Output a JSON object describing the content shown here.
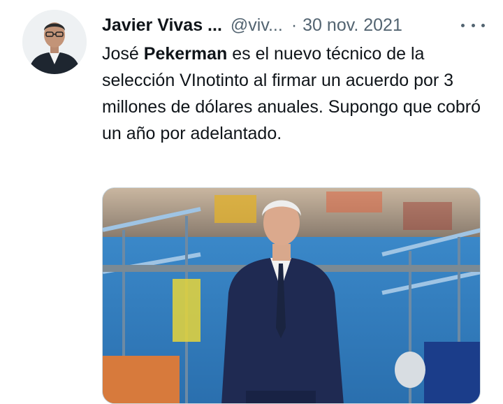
{
  "author": {
    "display_name": "Javier Vivas ...",
    "handle": "@viv...",
    "separator": "·",
    "date": "30 nov. 2021"
  },
  "tweet": {
    "text_part1": "José ",
    "text_bold": "Pekerman",
    "text_part2": " es el nuevo técnico de la selección VInotinto al firmar un acuerdo por 3 millones de dólares anuales. Supongo que cobró un año por adelantado."
  },
  "icons": {
    "more": "more-horizontal-icon",
    "avatar": "profile-avatar"
  },
  "colors": {
    "text": "#0f1419",
    "secondary": "#536471",
    "border": "#cfd9de",
    "suit": "#1f2a52"
  }
}
